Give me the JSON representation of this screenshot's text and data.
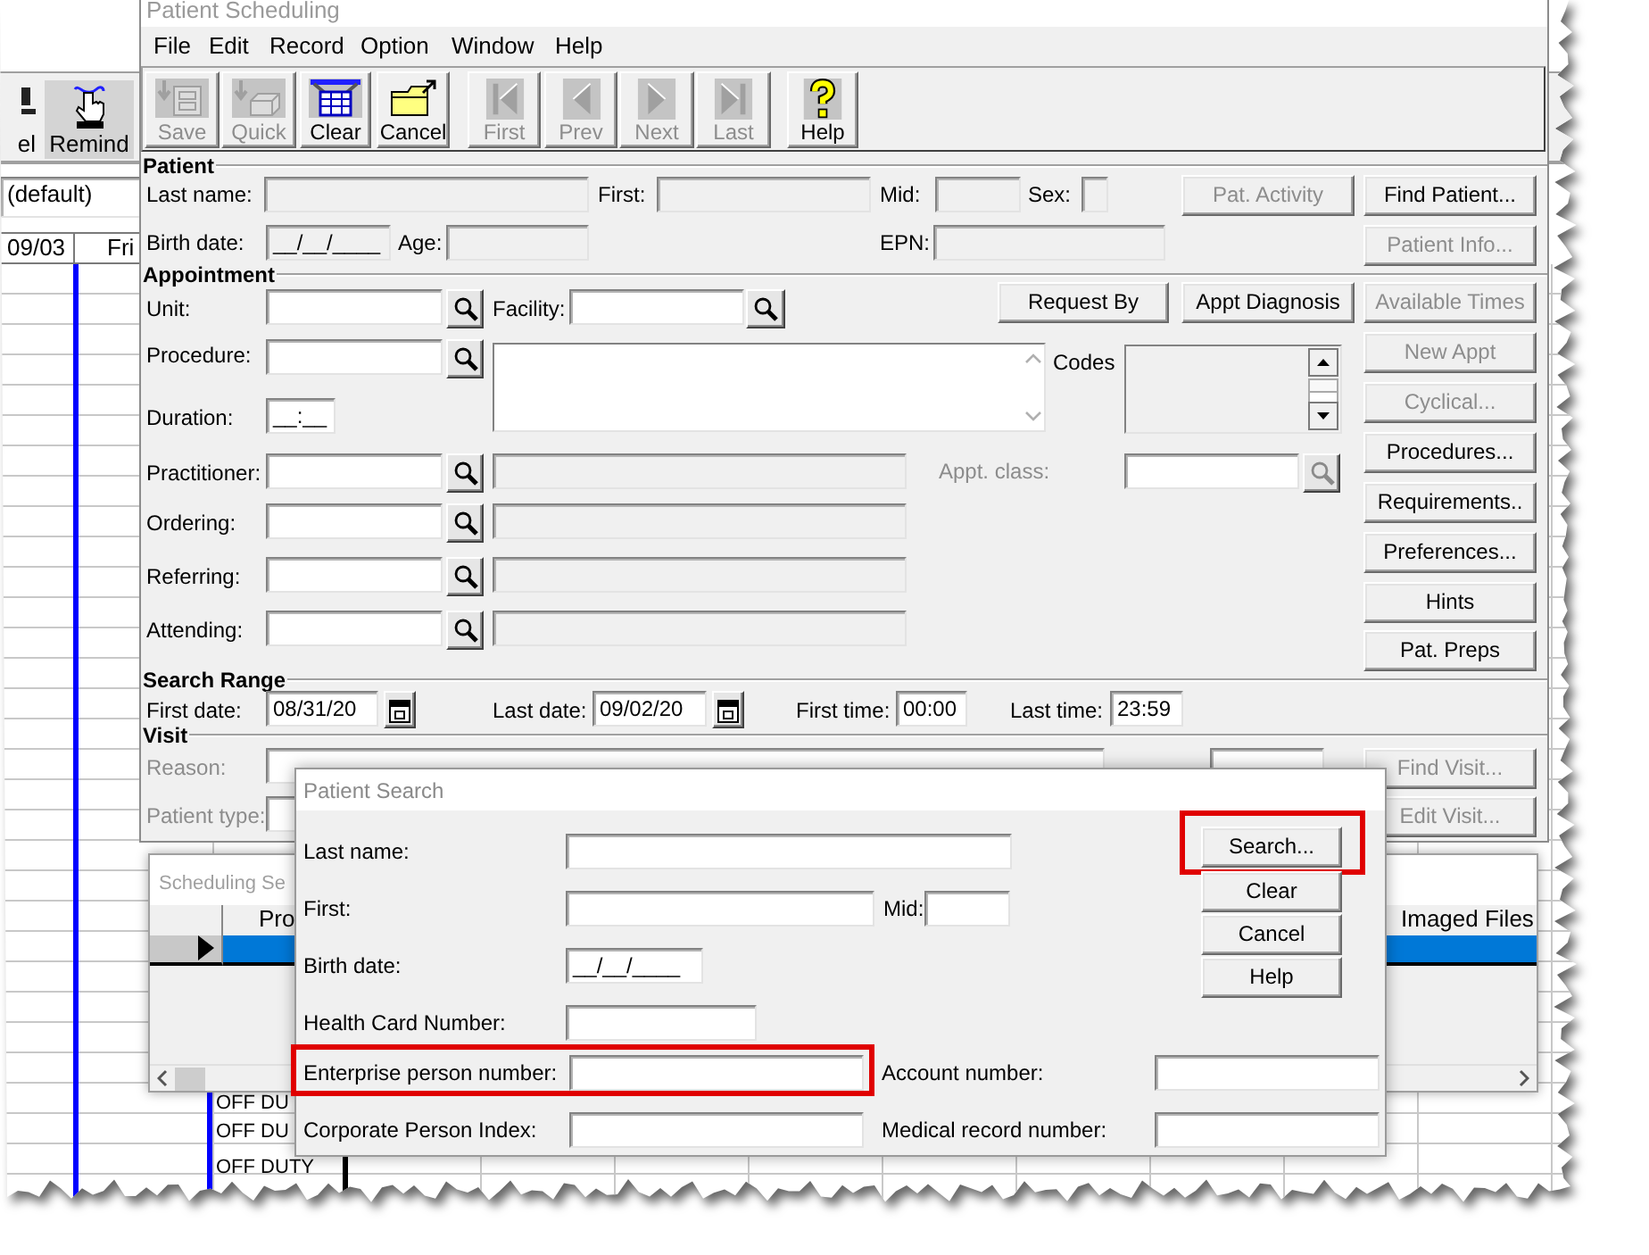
{
  "background_app": {
    "toolbar": [
      {
        "label": "el"
      },
      {
        "label": "Remind"
      }
    ],
    "view_field": "(default)",
    "day_headers": [
      "09/03",
      "Fri"
    ],
    "schedule_entries": [
      "OFF DU",
      "OFF DU",
      "OFF DUTY"
    ]
  },
  "main_window": {
    "title": "Patient Scheduling",
    "menu": [
      "File",
      "Edit",
      "Record",
      "Option",
      "Window",
      "Help"
    ],
    "toolbar": [
      {
        "label": "Save",
        "disabled": true
      },
      {
        "label": "Quick",
        "disabled": true
      },
      {
        "label": "Clear",
        "disabled": false
      },
      {
        "label": "Cancel",
        "disabled": false
      },
      {
        "label": "First",
        "disabled": true
      },
      {
        "label": "Prev",
        "disabled": true
      },
      {
        "label": "Next",
        "disabled": true
      },
      {
        "label": "Last",
        "disabled": true
      },
      {
        "label": "Help",
        "disabled": false
      }
    ],
    "patient": {
      "heading": "Patient",
      "fields": [
        {
          "label": "Last name:",
          "disabled": true
        },
        {
          "label": "First:",
          "disabled": true
        },
        {
          "label": "Mid:",
          "disabled": true
        },
        {
          "label": "Sex:",
          "disabled": true
        },
        {
          "label": "Birth date:",
          "value": "__/__/____",
          "disabled": true
        },
        {
          "label": "Age:",
          "disabled": true
        },
        {
          "label": "EPN:",
          "disabled": true
        }
      ],
      "buttons": [
        {
          "label": "Pat. Activity",
          "disabled": true
        },
        {
          "label": "Find Patient...",
          "disabled": false
        },
        {
          "label": "Patient Info...",
          "disabled": true
        }
      ]
    },
    "appointment": {
      "heading": "Appointment",
      "fields": [
        {
          "label": "Unit:"
        },
        {
          "label": "Facility:"
        },
        {
          "label": "Procedure:"
        },
        {
          "label": "Duration:",
          "value": "__:__"
        },
        {
          "label": "Practitioner:",
          "description": {
            "disabled": true
          }
        },
        {
          "label": "Ordering:",
          "description": {
            "disabled": true
          }
        },
        {
          "label": "Referring:",
          "description": {
            "disabled": true
          }
        },
        {
          "label": "Attending:",
          "description": {
            "disabled": true
          }
        }
      ],
      "codes_label": "Codes",
      "appt_class": {
        "label": "Appt. class:",
        "disabled": true
      },
      "buttons": [
        {
          "label": "Request By",
          "disabled": false
        },
        {
          "label": "Appt Diagnosis",
          "disabled": false
        },
        {
          "label": "Available Times",
          "disabled": true
        },
        {
          "label": "New Appt",
          "disabled": true
        },
        {
          "label": "Cyclical...",
          "disabled": true
        },
        {
          "label": "Procedures...",
          "disabled": false
        },
        {
          "label": "Requirements..",
          "disabled": false
        },
        {
          "label": "Preferences...",
          "disabled": false
        },
        {
          "label": "Hints",
          "disabled": false
        },
        {
          "label": "Pat. Preps",
          "disabled": false
        }
      ]
    },
    "search_range": {
      "heading": "Search Range",
      "fields": [
        {
          "label": "First date:",
          "value": "08/31/20",
          "kind": "date"
        },
        {
          "label": "Last date:",
          "value": "09/02/20",
          "kind": "date"
        },
        {
          "label": "First time:",
          "value": "00:00",
          "kind": "time"
        },
        {
          "label": "Last time:",
          "value": "23:59",
          "kind": "time"
        }
      ]
    },
    "visit": {
      "heading": "Visit",
      "fields": [
        {
          "label": "Reason:",
          "disabled": true
        },
        {
          "label": "Patient type:",
          "disabled": true
        }
      ],
      "buttons": [
        {
          "label": "Find Visit...",
          "disabled": true
        },
        {
          "label": "Edit Visit...",
          "disabled": true
        }
      ]
    }
  },
  "scheduling_search": {
    "title": "Scheduling Se",
    "columns": [
      "Pro",
      "Imaged Files"
    ],
    "rows": [
      {
        "selected": true
      }
    ]
  },
  "patient_search": {
    "title": "Patient Search",
    "fields": [
      {
        "label": "Last name:",
        "highlighted": false
      },
      {
        "label": "First:",
        "highlighted": false
      },
      {
        "label": "Mid:",
        "highlighted": false
      },
      {
        "label": "Birth date:",
        "value": "__/__/____",
        "highlighted": false
      },
      {
        "label": "Health Card Number:",
        "highlighted": false
      },
      {
        "label": "Enterprise person number:",
        "highlighted": true
      },
      {
        "label": "Account number:",
        "highlighted": false
      },
      {
        "label": "Corporate Person Index:",
        "highlighted": false
      },
      {
        "label": "Medical record number:",
        "highlighted": false
      }
    ],
    "buttons": [
      {
        "label": "Search...",
        "highlighted": true
      },
      {
        "label": "Clear",
        "highlighted": false
      },
      {
        "label": "Cancel",
        "highlighted": false
      },
      {
        "label": "Help",
        "highlighted": false
      }
    ]
  }
}
